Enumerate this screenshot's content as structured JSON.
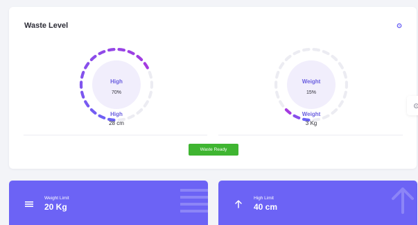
{
  "waste_card": {
    "title": "Waste Level",
    "gauges": [
      {
        "center_label": "High",
        "center_value": "70%",
        "percent": 70,
        "sub_label": "High",
        "sub_value": "28 cm"
      },
      {
        "center_label": "Weight",
        "center_value": "15%",
        "percent": 15,
        "sub_label": "Weight",
        "sub_value": "3 Kg"
      }
    ],
    "status_button_label": "Waste Ready"
  },
  "stats": [
    {
      "label": "Weight Limit",
      "value": "20 Kg",
      "icon": "menu-lines-icon"
    },
    {
      "label": "High Limit",
      "value": "40 cm",
      "icon": "arrow-up-icon"
    }
  ],
  "colors": {
    "accent": "#6c63f5",
    "gauge_fill_start": "#6c63f5",
    "gauge_fill_end": "#a43ae0",
    "gauge_track": "#ececf2",
    "ready_button": "#3fb531"
  }
}
